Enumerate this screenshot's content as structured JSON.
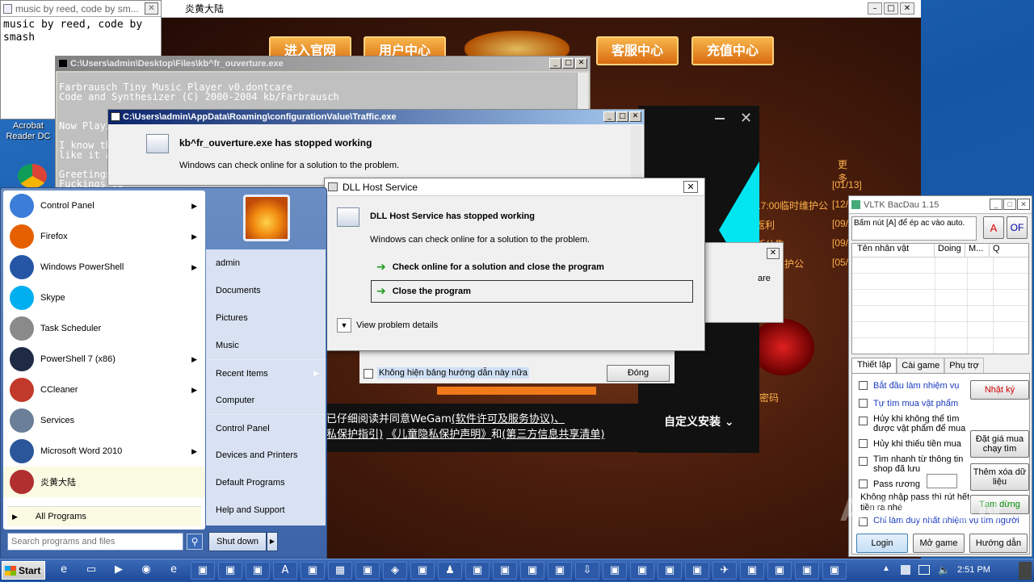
{
  "notepad": {
    "title": "music by reed, code by sm...",
    "content": "music by reed, code by smash"
  },
  "desktop_icons": [
    {
      "label": "Acrobat Reader DC"
    }
  ],
  "game": {
    "title": "炎黄大陆",
    "nav": [
      "进入官网",
      "用户中心",
      "客服中心",
      "充值中心"
    ],
    "more": "更多",
    "news": [
      {
        "text": "",
        "date": "[01/13]"
      },
      {
        "text": "17:00临时维护公",
        "date": "[12/"
      },
      {
        "text": "返利",
        "date": "[09/"
      },
      {
        "text": "新公告",
        "date": "[09/"
      },
      {
        "text": "志时维护公",
        "date": "[05/"
      }
    ],
    "partial_text": "are",
    "password_link": "密码"
  },
  "console": {
    "title": "C:\\Users\\admin\\Desktop\\Files\\kb^fr_ouverture.exe",
    "lines": [
      "Farbrausch Tiny Music Player v0.dontcare",
      "Code and Synthesizer (C) 2000-2004 kb/Farbrausch",
      "",
      "Now Playing:",
      "",
      "I know this",
      "like it anyw",
      "",
      "Greetings to",
      "Fuckings to"
    ]
  },
  "traffic_dialog": {
    "title": "C:\\Users\\admin\\AppData\\Roaming\\configurationValue\\Traffic.exe",
    "heading": "kb^fr_ouverture.exe has stopped working",
    "body": "Windows can check online for a solution to the problem."
  },
  "dll_dialog": {
    "title": "DLL Host Service",
    "heading": "DLL Host Service has stopped working",
    "body": "Windows can check online for a solution to the problem.",
    "option1": "Check online for a solution and close the program",
    "option2": "Close the program",
    "details": "View problem details"
  },
  "wegame": {
    "checkbox_label": "Không hiện bảng hướng dẫn này nữa",
    "close_btn": "Đóng",
    "agree_line1": "已仔细阅读并同意WeGam",
    "agree_link1": "(软件许可及服务协议)、",
    "agree_link2": "私保护指引)",
    "agree_link3": "《儿童隐私保护声明》",
    "agree_and": "和",
    "agree_link4": "(第三方信息共享清单)",
    "custom_install": "自定义安装"
  },
  "start_menu": {
    "left_items": [
      {
        "label": "Control Panel",
        "arrow": true,
        "icon": "control-panel-icon",
        "color": "#3b7dd8"
      },
      {
        "label": "Firefox",
        "arrow": true,
        "icon": "firefox-icon",
        "color": "#e66000"
      },
      {
        "label": "Windows PowerShell",
        "arrow": true,
        "icon": "powershell-icon",
        "color": "#2456a5"
      },
      {
        "label": "Skype",
        "arrow": false,
        "icon": "skype-icon",
        "color": "#00aff0"
      },
      {
        "label": "Task Scheduler",
        "arrow": false,
        "icon": "task-scheduler-icon",
        "color": "#8a8a8a"
      },
      {
        "label": "PowerShell 7 (x86)",
        "arrow": true,
        "icon": "powershell7-icon",
        "color": "#1f2a44"
      },
      {
        "label": "CCleaner",
        "arrow": true,
        "icon": "ccleaner-icon",
        "color": "#c0392b"
      },
      {
        "label": "Services",
        "arrow": false,
        "icon": "services-icon",
        "color": "#6b7f99"
      },
      {
        "label": "Microsoft Word 2010",
        "arrow": true,
        "icon": "word-icon",
        "color": "#2b579a"
      },
      {
        "label": "炎黄大陆",
        "arrow": false,
        "icon": "game-icon",
        "color": "#b03030"
      }
    ],
    "all_programs": "All Programs",
    "search_placeholder": "Search programs and files",
    "right_items": [
      "admin",
      "Documents",
      "Pictures",
      "Music",
      "Recent Items",
      "Computer",
      "Control Panel",
      "Devices and Printers",
      "Default Programs",
      "Help and Support"
    ],
    "shutdown": "Shut down"
  },
  "vltk": {
    "title": "VLTK BacDau 1.15",
    "hint": "Bấm nút [A] để ép ac vào auto.",
    "btn_a": "A",
    "btn_of": "OF",
    "columns": [
      "Tên nhân vật",
      "Doing",
      "M...",
      "Q"
    ],
    "tabs": [
      "Thiết lập",
      "Cài game",
      "Phụ trợ"
    ],
    "options": [
      {
        "label": "Bắt đầu làm nhiệm vụ",
        "blue": true
      },
      {
        "label": "Tự tìm mua vật phẩm",
        "blue": true
      },
      {
        "label": "Hủy khi không thể tìm được vật phẩm để mua",
        "blue": false
      },
      {
        "label": "Hủy khi thiếu tiền mua",
        "blue": false
      },
      {
        "label": "Tìm nhanh từ thông tin shop đã lưu",
        "blue": false
      },
      {
        "label": "Pass rương",
        "blue": false
      }
    ],
    "note": "Không nhập pass thì rút hết tiền ra nhé",
    "last_option": "Chỉ làm duy nhất nhiệm vụ tìm người",
    "btn_log": "Nhật ký",
    "btn_price": "Đặt giá mua chạy tìm",
    "btn_add": "Thêm xóa dữ liệu",
    "btn_pause": "Tạm dừng",
    "btn_login": "Login",
    "btn_open": "Mở game",
    "btn_guide": "Hướng dẫn"
  },
  "taskbar": {
    "start": "Start",
    "icons": [
      "ie-icon",
      "folder-icon",
      "media-icon",
      "chrome-icon",
      "edge-icon",
      "app-icon",
      "app-icon",
      "app-icon",
      "acrobat-icon",
      "app-icon",
      "calc-icon",
      "app-icon",
      "game-icon",
      "app-icon",
      "person-icon",
      "app-icon",
      "app-icon",
      "app-icon",
      "app-icon",
      "download-icon",
      "app-icon",
      "app-icon",
      "app-icon",
      "app-icon",
      "bird-icon",
      "app-icon",
      "app-icon",
      "app-icon",
      "app-icon",
      "app-icon",
      "app-icon"
    ],
    "time": "2:51 PM"
  },
  "watermark": "ANY.RUN"
}
